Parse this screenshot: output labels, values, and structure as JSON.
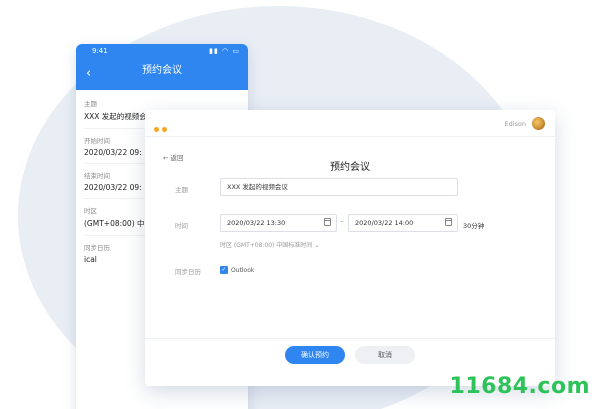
{
  "phone": {
    "time": "9:41",
    "status_icons": "▮▮ ◠ ▭",
    "back_icon": "‹",
    "title": "预约会议",
    "fields": [
      {
        "label": "主题",
        "value": "XXX 发起的视频会议"
      },
      {
        "label": "开始时间",
        "value": "2020/03/22  09:"
      },
      {
        "label": "结束时间",
        "value": "2020/03/22  09:"
      },
      {
        "label": "时区",
        "value": "(GMT+08:00) 中国"
      },
      {
        "label": "同步日历",
        "value": "ical"
      }
    ]
  },
  "window": {
    "user_name": "Edison",
    "back_label": "← 返回",
    "title": "预约会议",
    "subject_label": "主题",
    "subject_value": "XXX  发起的视频会议",
    "time_label": "时间",
    "start_value": "2020/03/22   13:30",
    "separator": "–",
    "end_value": "2020/03/22   14:00",
    "duration": "30分钟",
    "timezone": "时区  (GMT+08:00) 中国标准时间",
    "timezone_chevron": "⌄",
    "sync_label": "同步日历",
    "outlook_label": "Outlook",
    "check_mark": "✓",
    "confirm_button": "确认预约",
    "cancel_button": "取消"
  },
  "watermark": "11684.com"
}
